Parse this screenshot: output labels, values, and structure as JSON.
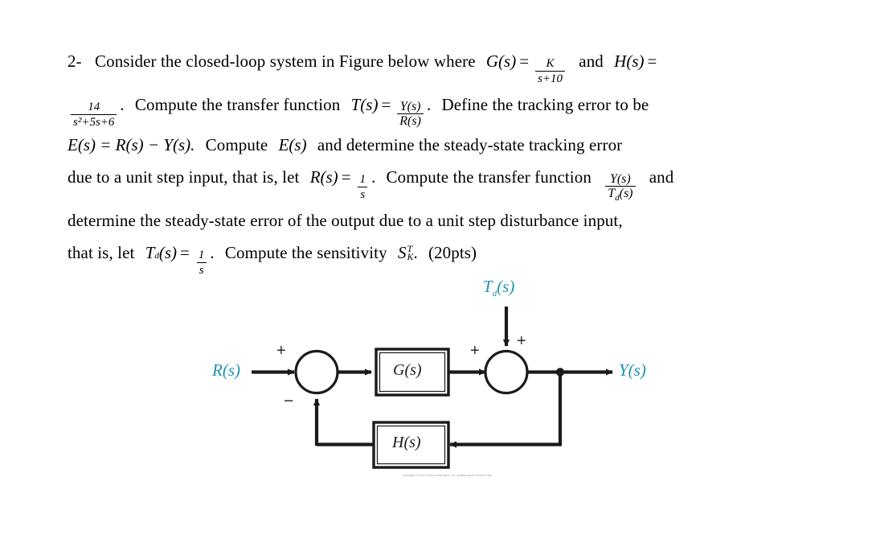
{
  "problem": {
    "number": "2-",
    "line1": {
      "a": "Consider the closed-loop system in Figure below where",
      "g_lhs": "G(s)",
      "eq": "=",
      "g_num": "K",
      "g_den": "s+10",
      "b": "and",
      "h_lhs": "H(s)",
      "eq2": "="
    },
    "line2": {
      "h_num": "14",
      "h_den": "s²+5s+6",
      "dot": ".",
      "a": "Compute the transfer function",
      "t_lhs": "T(s)",
      "eq": "=",
      "t_num": "Y(s)",
      "t_den": "R(s)",
      "period": ".",
      "b": "Define the tracking error to be"
    },
    "line3": {
      "e_eq": "E(s) = R(s) − Y(s).",
      "a": "Compute",
      "e_s": "E(s)",
      "b": "and determine the steady-state tracking error"
    },
    "line4": {
      "a": "due to a unit step input, that is, let",
      "r_s": "R(s)",
      "eq": "=",
      "frac_num": "1",
      "frac_den": "s",
      "period": ".",
      "b": "Compute the transfer function",
      "y_num": "Y(s)",
      "y_den": "Tₓ(s)",
      "y_den_base": "T",
      "y_den_sub": "d",
      "y_den_tail": "(s)",
      "c": "and"
    },
    "line5": {
      "a": "determine the steady-state error of the output due to a unit step disturbance input,"
    },
    "line6": {
      "a": "that is, let",
      "td_base": "T",
      "td_sub": "d",
      "td_tail": "(s)",
      "eq": "=",
      "frac_num": "1",
      "frac_den": "s",
      "period": ".",
      "b": "Compute the sensitivity",
      "sens_base": "S",
      "sens_sup": "T",
      "sens_sub": "K",
      "sens_period": ".",
      "points": "(20pts)"
    }
  },
  "diagram": {
    "input_label": "R(s)",
    "output_label": "Y(s)",
    "disturbance_label": "Tₓ(s)",
    "disturbance_base": "T",
    "disturbance_sub": "d",
    "disturbance_tail": "(s)",
    "forward_block_label": "G(s)",
    "feedback_block_label": "H(s)",
    "sign_input_plus": "+",
    "sign_feedback_minus": "−",
    "sign_forward_plus": "+",
    "sign_disturbance_plus": "+",
    "colors": {
      "signal_label": "#1b93b0",
      "line": "#1a1a1a",
      "block_fill": "#ffffff"
    },
    "copyright": "Copyright © 2011 Pearson Education, Inc. publishing as Prentice Hall"
  }
}
